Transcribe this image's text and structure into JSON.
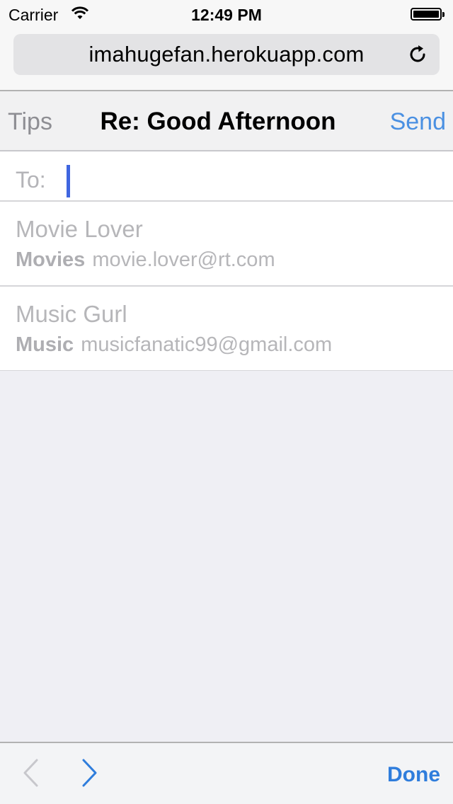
{
  "status_bar": {
    "carrier": "Carrier",
    "time": "12:49 PM",
    "icons": [
      "wifi-icon",
      "battery-icon"
    ]
  },
  "url_bar": {
    "url": "imahugefan.herokuapp.com",
    "reload_icon": "reload-icon"
  },
  "nav": {
    "left_label": "Tips",
    "title": "Re: Good Afternoon",
    "right_label": "Send"
  },
  "to_field": {
    "label": "To:",
    "value": ""
  },
  "suggestions": [
    {
      "name": "Movie Lover",
      "category": "Movies",
      "email": "movie.lover@rt.com"
    },
    {
      "name": "Music Gurl",
      "category": "Music",
      "email": "musicfanatic99@gmail.com"
    }
  ],
  "keyboard_toolbar": {
    "prev_icon": "chevron-left-icon",
    "next_icon": "chevron-right-icon",
    "done_label": "Done"
  },
  "colors": {
    "accent_blue": "#4a90e2",
    "done_blue": "#2f7ddc",
    "caret_blue": "#3f66e0"
  }
}
